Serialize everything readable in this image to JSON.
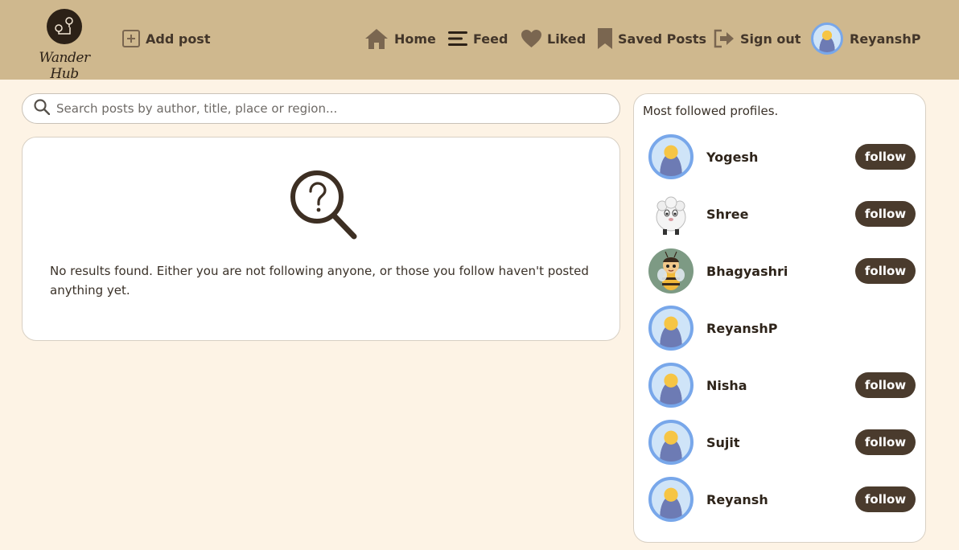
{
  "app": {
    "logo_text": "Wander Hub"
  },
  "nav": {
    "add_post": "Add post",
    "home": "Home",
    "feed": "Feed",
    "liked": "Liked",
    "saved": "Saved Posts",
    "signout": "Sign out",
    "user": "ReyanshP"
  },
  "search": {
    "placeholder": "Search posts by author, title, place or region...",
    "value": ""
  },
  "empty_state": {
    "message": "No results found. Either you are not following anyone, or those you follow haven't posted anything yet."
  },
  "sidebar": {
    "title": "Most followed profiles.",
    "follow_label": "follow",
    "profiles": [
      {
        "name": "Yogesh",
        "avatar": "default-avatar-icon",
        "followable": true
      },
      {
        "name": "Shree",
        "avatar": "sheep-avatar-icon",
        "followable": true
      },
      {
        "name": "Bhagyashri",
        "avatar": "bee-avatar-icon",
        "followable": true
      },
      {
        "name": "ReyanshP",
        "avatar": "default-avatar-icon",
        "followable": false
      },
      {
        "name": "Nisha",
        "avatar": "default-avatar-icon",
        "followable": true
      },
      {
        "name": "Sujit",
        "avatar": "default-avatar-icon",
        "followable": true
      },
      {
        "name": "Reyansh",
        "avatar": "default-avatar-icon",
        "followable": true
      }
    ]
  },
  "colors": {
    "header_bg": "#cfb88e",
    "page_bg": "#fdf3e5",
    "button_bg": "#4a3b2d",
    "avatar_ring": "#78a7ea"
  }
}
